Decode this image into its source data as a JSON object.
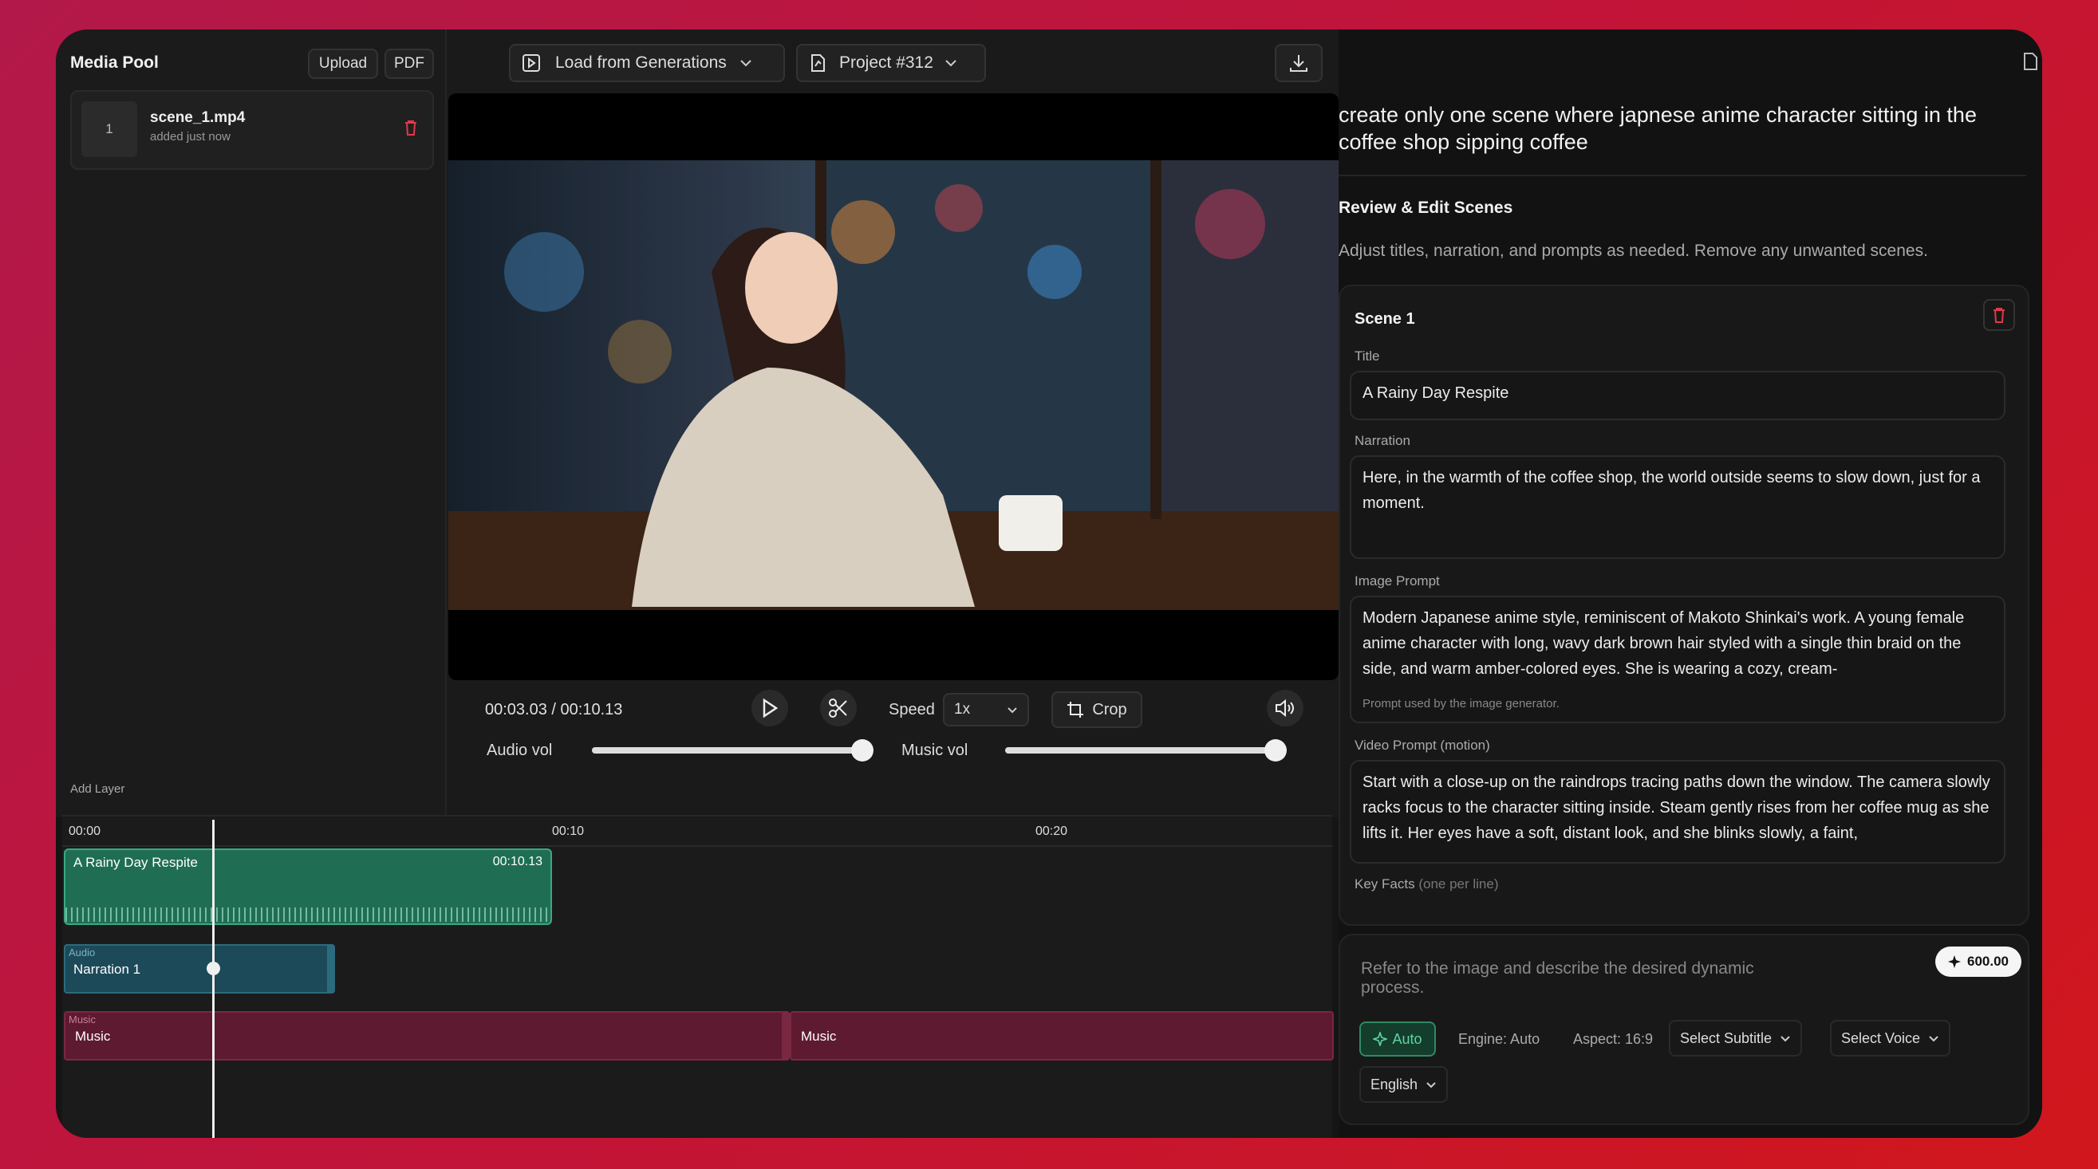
{
  "media_pool": {
    "title": "Media Pool",
    "upload": "Upload",
    "pdf": "PDF",
    "items": [
      {
        "index": "1",
        "name": "scene_1.mp4",
        "meta": "added just now"
      }
    ],
    "add_layer": "Add Layer"
  },
  "toolbar": {
    "load_from_generations": "Load from Generations",
    "project": "Project #312"
  },
  "player": {
    "time": "00:03.03 / 00:10.13",
    "speed_label": "Speed",
    "speed_value": "1x",
    "crop": "Crop",
    "audio_vol_label": "Audio vol",
    "music_vol_label": "Music vol",
    "audio_vol": 1.0,
    "music_vol": 1.0
  },
  "timeline": {
    "ruler": [
      "00:00",
      "00:10",
      "00:20"
    ],
    "video_clip": {
      "title": "A Rainy Day Respite",
      "duration": "00:10.13"
    },
    "audio_track": {
      "tag": "Audio",
      "clip": "Narration 1"
    },
    "music_track": {
      "tag": "Music",
      "clip1": "Music",
      "clip2": "Music"
    }
  },
  "right_panel": {
    "prompt": "create only one scene where japnese anime character sitting in the coffee shop sipping coffee",
    "review_title": "Review & Edit Scenes",
    "review_desc": "Adjust titles, narration, and prompts as needed. Remove any unwanted scenes.",
    "scene": {
      "name": "Scene 1",
      "title_label": "Title",
      "title_value": "A Rainy Day Respite",
      "narration_label": "Narration",
      "narration_value": "Here, in the warmth of the coffee shop, the world outside seems to slow down, just for a moment.",
      "image_prompt_label": "Image Prompt",
      "image_prompt_value": "Modern Japanese anime style, reminiscent of Makoto Shinkai's work. A young female anime character with long, wavy dark brown hair styled with a single thin braid on the side, and warm amber-colored eyes. She is wearing a cozy, cream-",
      "image_prompt_hint": "Prompt used by the image generator.",
      "video_prompt_label": "Video Prompt (motion)",
      "video_prompt_value": "Start with a close-up on the raindrops tracing paths down the window. The camera slowly racks focus to the character sitting inside. Steam gently rises from her coffee mug as she lifts it. Her eyes have a soft, distant look, and she blinks slowly, a faint,",
      "key_facts_label": "Key Facts",
      "key_facts_hint": "(one per line)"
    },
    "composer": {
      "placeholder": "Refer to the image and describe the desired dynamic process.",
      "credits": "600.00",
      "auto": "Auto",
      "engine": "Engine: Auto",
      "aspect": "Aspect: 16:9",
      "subtitle": "Select Subtitle",
      "voice": "Select Voice",
      "language": "English"
    }
  },
  "colors": {
    "accent_green": "#1f7a5e",
    "audio_teal": "#1d4a58",
    "music_maroon": "#5e1a30",
    "danger": "#e0394a"
  }
}
